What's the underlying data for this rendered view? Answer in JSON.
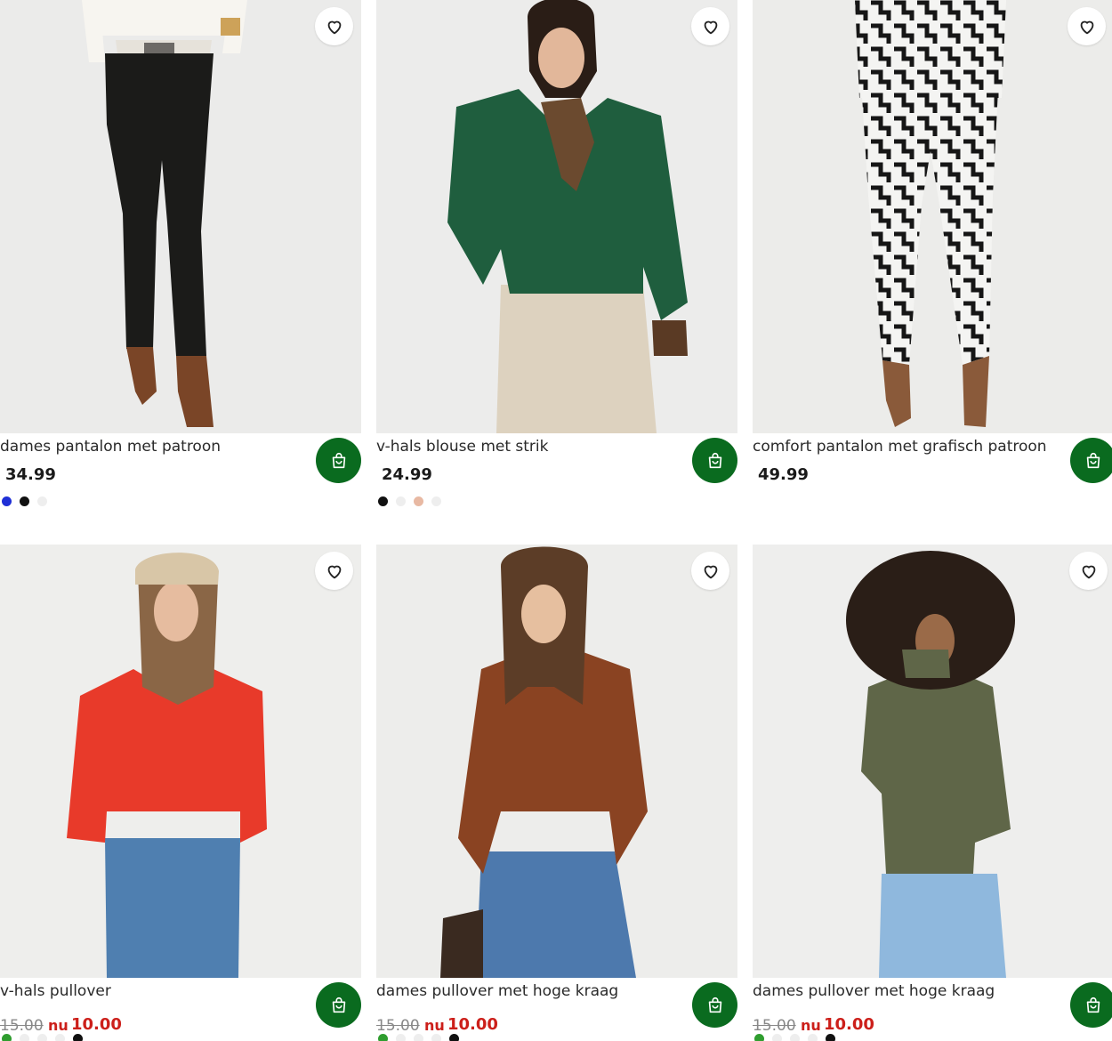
{
  "products": [
    {
      "name": "dames pantalon met patroon",
      "price": "34.99",
      "swatches": [
        "#1f2fd6",
        "#111111",
        "#eeeeee"
      ]
    },
    {
      "name": "v-hals blouse met strik",
      "price": "24.99",
      "swatches": [
        "#111111",
        "#eeeeee",
        "#e8b9a3",
        "#eeeeee"
      ]
    },
    {
      "name": "comfort pantalon met grafisch patroon",
      "price": "49.99",
      "swatches": []
    },
    {
      "name": "v-hals pullover",
      "old_price": "15.00",
      "nu_label": "nu",
      "new_price": "10.00",
      "swatches": [
        "#2f9d2f",
        "#eeeeee",
        "#eeeeee",
        "#eeeeee",
        "#111111"
      ]
    },
    {
      "name": "dames pullover met hoge kraag",
      "old_price": "15.00",
      "nu_label": "nu",
      "new_price": "10.00",
      "swatches": [
        "#2f9d2f",
        "#eeeeee",
        "#eeeeee",
        "#eeeeee",
        "#111111"
      ]
    },
    {
      "name": "dames pullover met hoge kraag",
      "old_price": "15.00",
      "nu_label": "nu",
      "new_price": "10.00",
      "swatches": [
        "#2f9d2f",
        "#eeeeee",
        "#eeeeee",
        "#eeeeee",
        "#111111"
      ]
    }
  ],
  "icons": {
    "favorite": "heart-icon",
    "cart": "shopping-bag-icon"
  },
  "colors": {
    "cart_button": "#0a6b1f",
    "sale_price": "#cc1f1a"
  }
}
